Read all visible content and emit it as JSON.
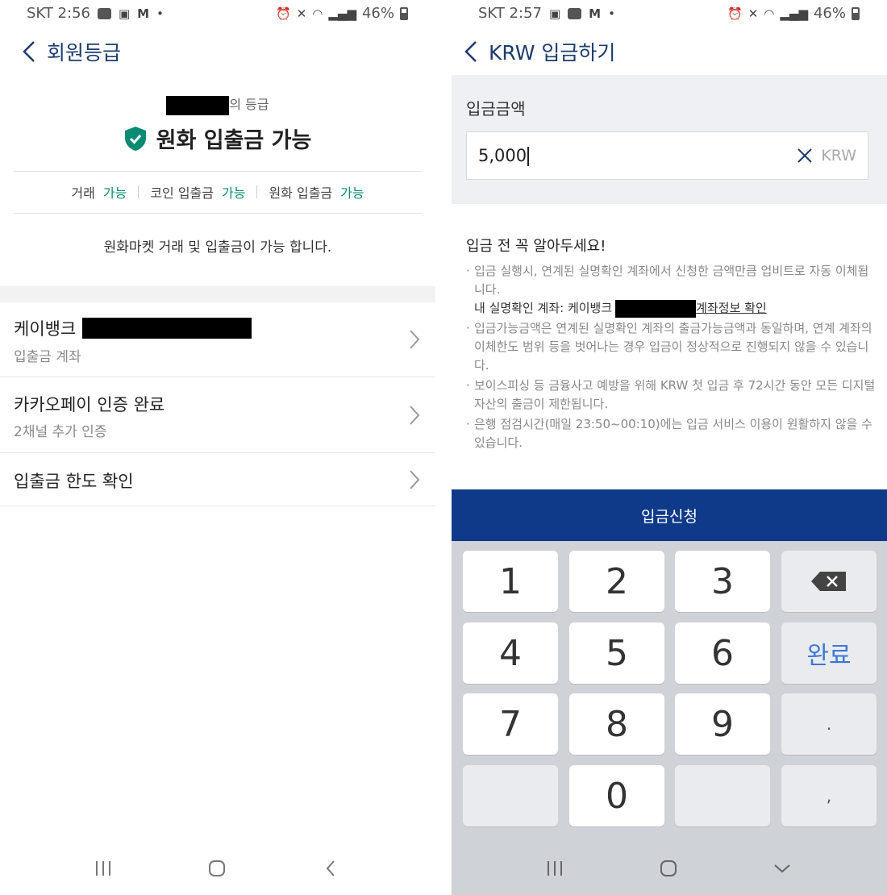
{
  "left": {
    "status": {
      "carrier_time": "SKT 2:56",
      "battery": "46%"
    },
    "title": "회원등급",
    "grade_suffix": "의 등급",
    "grade_name": "원화 입출금 가능",
    "permissions": [
      {
        "label": "거래",
        "value": "가능"
      },
      {
        "label": "코인 입출금",
        "value": "가능"
      },
      {
        "label": "원화 입출금",
        "value": "가능"
      }
    ],
    "notice": "원화마켓 거래 및 입출금이 가능 합니다.",
    "menu": [
      {
        "title": "케이뱅크",
        "subtitle": "입출금 계좌"
      },
      {
        "title": "카카오페이 인증 완료",
        "subtitle": "2채널 추가 인증"
      },
      {
        "title": "입출금 한도 확인",
        "subtitle": ""
      }
    ],
    "icons": {
      "grade": "shield-check-icon",
      "accent": "#0b8a73"
    }
  },
  "right": {
    "status": {
      "carrier_time": "SKT 2:57",
      "battery": "46%"
    },
    "title": "KRW 입금하기",
    "input_label": "입금금액",
    "amount": "5,000",
    "unit": "KRW",
    "info_title": "입금 전 꼭 알아두세요!",
    "info": {
      "item1": "입금 실행시, 연계된 실명확인 계좌에서 신청한 금액만큼 업비트로 자동 이체됩니다.",
      "account_prefix": "내 실명확인 계좌: 케이뱅크",
      "account_link": "계좌정보 확인",
      "item2": "입금가능금액은 연계된 실명확인 계좌의 출금가능금액과 동일하며, 연계 계좌의 이체한도 범위 등을 벗어나는 경우 입금이 정상적으로 진행되지 않을 수 있습니다.",
      "item3": "보이스피싱 등 금융사고 예방을 위해 KRW 첫 입금 후 72시간 동안 모든 디지털 자산의 출금이 제한됩니다.",
      "item4": "은행 점검시간(매일 23:50~00:10)에는 입금 서비스 이용이 원활하지 않을 수 있습니다."
    },
    "submit": "입금신청",
    "keys": {
      "k1": "1",
      "k2": "2",
      "k3": "3",
      "k4": "4",
      "k5": "5",
      "k6": "6",
      "k7": "7",
      "k8": "8",
      "k9": "9",
      "k0": "0",
      "done": "완료",
      "dot": ".",
      "comma": ","
    },
    "brand_color": "#0f3a8a"
  }
}
